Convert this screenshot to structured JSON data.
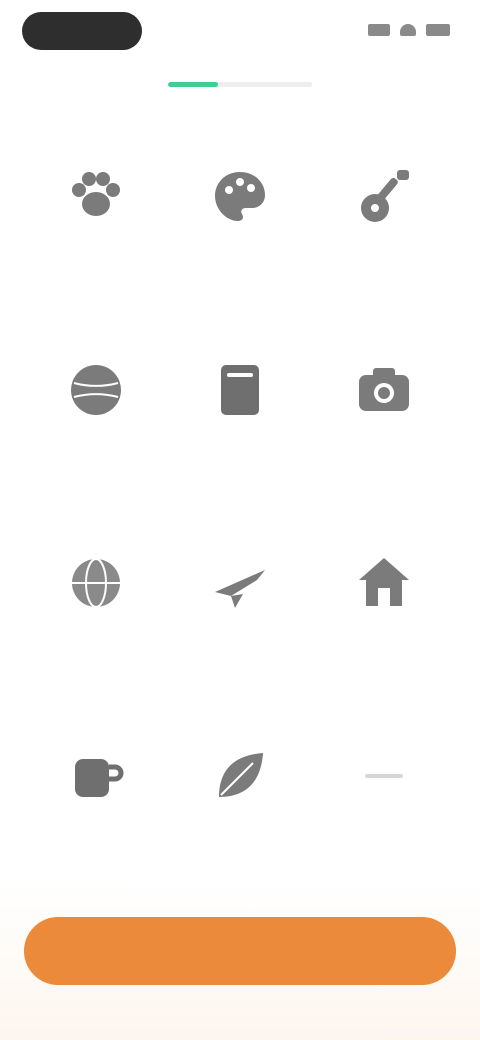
{
  "progress": {
    "fraction": 0.35,
    "fill_color": "#3fcf90"
  },
  "categories": [
    {
      "icon": "paw-icon",
      "label": ""
    },
    {
      "icon": "palette-icon",
      "label": ""
    },
    {
      "icon": "guitar-icon",
      "label": ""
    },
    {
      "icon": "ball-icon",
      "label": ""
    },
    {
      "icon": "book-icon",
      "label": ""
    },
    {
      "icon": "camera-icon",
      "label": ""
    },
    {
      "icon": "globe-icon",
      "label": ""
    },
    {
      "icon": "plane-icon",
      "label": ""
    },
    {
      "icon": "house-icon",
      "label": ""
    },
    {
      "icon": "cup-icon",
      "label": ""
    },
    {
      "icon": "leaf-icon",
      "label": ""
    },
    {
      "icon": "more-icon",
      "label": ""
    }
  ],
  "continue_button": {
    "label": "",
    "color": "#ea8a3a"
  }
}
